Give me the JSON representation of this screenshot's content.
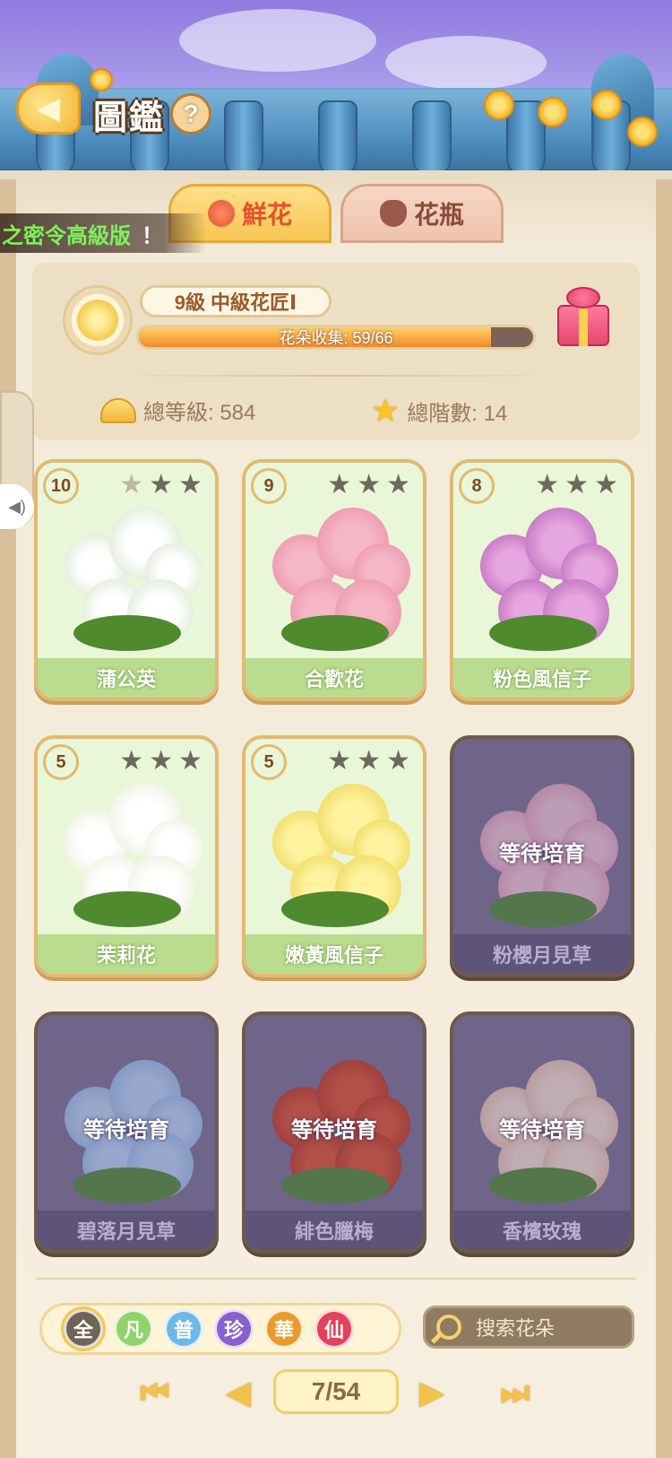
{
  "header": {
    "title": "圖鑑",
    "help_icon_label": "?",
    "back_icon": "back-arrow-icon"
  },
  "tabs": [
    {
      "label": "鮮花",
      "icon": "rose-icon",
      "active": true
    },
    {
      "label": "花瓶",
      "icon": "vase-icon",
      "active": false
    }
  ],
  "ticker": {
    "text": "之密令高級版",
    "suffix": "！"
  },
  "profile": {
    "level_text": "9級",
    "rank_text": "中級花匠Ⅰ",
    "progress_text": "花朵收集: 59/66",
    "progress_value": 0.894,
    "total_level_label": "總等級: 584",
    "total_stars_label": "總階數: 14"
  },
  "cards": [
    {
      "name": "蒲公英",
      "level": "10",
      "stars": 3,
      "filled_stars": 1,
      "locked": false,
      "colors": [
        "#ffffff",
        "#e6efe0"
      ]
    },
    {
      "name": "合歡花",
      "level": "9",
      "stars": 3,
      "filled_stars": 0,
      "locked": false,
      "colors": [
        "#f5b7c6",
        "#ee9fb3"
      ]
    },
    {
      "name": "粉色風信子",
      "level": "8",
      "stars": 3,
      "filled_stars": 0,
      "locked": false,
      "colors": [
        "#e6a6df",
        "#c97ec8"
      ]
    },
    {
      "name": "茉莉花",
      "level": "5",
      "stars": 3,
      "filled_stars": 0,
      "locked": false,
      "colors": [
        "#ffffff",
        "#f3f5ea"
      ]
    },
    {
      "name": "嫩黃風信子",
      "level": "5",
      "stars": 3,
      "filled_stars": 0,
      "locked": false,
      "colors": [
        "#fff3a0",
        "#f2e070"
      ]
    },
    {
      "name": "粉櫻月見草",
      "locked": true,
      "locked_text": "等待培育",
      "colors": [
        "#f2c6d2",
        "#e7a9bd"
      ]
    },
    {
      "name": "碧落月見草",
      "locked": true,
      "locked_text": "等待培育",
      "colors": [
        "#b9d6f2",
        "#9cc2ea"
      ]
    },
    {
      "name": "緋色臘梅",
      "locked": true,
      "locked_text": "等待培育",
      "colors": [
        "#e0502a",
        "#c43a1a"
      ]
    },
    {
      "name": "香檳玫瑰",
      "locked": true,
      "locked_text": "等待培育",
      "colors": [
        "#f6dfcf",
        "#ebc7b0"
      ]
    }
  ],
  "filters": [
    {
      "label": "全",
      "color": "#6e6558",
      "active": true
    },
    {
      "label": "凡",
      "color": "#8fd36a"
    },
    {
      "label": "普",
      "color": "#6fb7e6"
    },
    {
      "label": "珍",
      "color": "#8a5fd0"
    },
    {
      "label": "華",
      "color": "#e99a2a"
    },
    {
      "label": "仙",
      "color": "#e0435a"
    }
  ],
  "search": {
    "placeholder": "搜索花朵"
  },
  "pagination": {
    "current": "7/54",
    "first_icon": "first-page-icon",
    "prev_icon": "prev-page-icon",
    "next_icon": "next-page-icon",
    "last_icon": "last-page-icon"
  }
}
